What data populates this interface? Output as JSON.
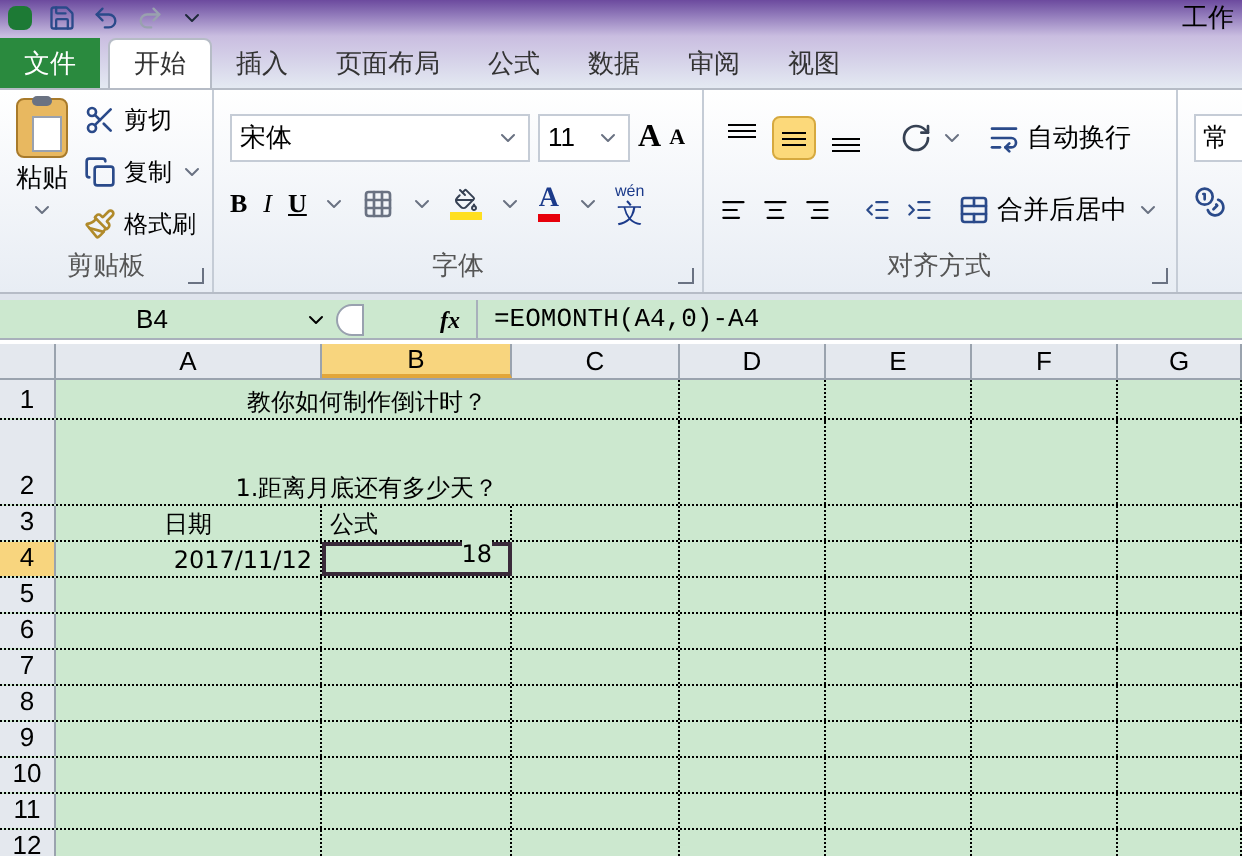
{
  "title_bar": {
    "title": "工作"
  },
  "tabs": [
    {
      "label": "文件",
      "kind": "file",
      "selected": false
    },
    {
      "label": "开始",
      "kind": "tab",
      "selected": true
    },
    {
      "label": "插入",
      "kind": "tab",
      "selected": false
    },
    {
      "label": "页面布局",
      "kind": "tab",
      "selected": false
    },
    {
      "label": "公式",
      "kind": "tab",
      "selected": false
    },
    {
      "label": "数据",
      "kind": "tab",
      "selected": false
    },
    {
      "label": "审阅",
      "kind": "tab",
      "selected": false
    },
    {
      "label": "视图",
      "kind": "tab",
      "selected": false
    }
  ],
  "clipboard": {
    "paste": "粘贴",
    "cut": "剪切",
    "copy": "复制",
    "format_painter": "格式刷",
    "label": "剪贴板"
  },
  "font": {
    "name": "宋体",
    "size": "11",
    "grow": "A",
    "shrink": "A",
    "bold": "B",
    "italic": "I",
    "underline": "U",
    "font_color": "A",
    "phonetic_top": "wén",
    "phonetic": "文",
    "label": "字体"
  },
  "alignment": {
    "vertical": [
      {
        "kind": "top",
        "selected": false
      },
      {
        "kind": "middle",
        "selected": true
      },
      {
        "kind": "bottom",
        "selected": false
      }
    ],
    "wrap": "自动换行",
    "merge": "合并后居中",
    "label": "对齐方式"
  },
  "number": {
    "format": "常"
  },
  "formula_bar": {
    "name_box": "B4",
    "fx": "fx",
    "formula": "=EOMONTH(A4,0)-A4"
  },
  "sheet": {
    "columns": [
      {
        "label": "A",
        "selected": false
      },
      {
        "label": "B",
        "selected": true
      },
      {
        "label": "C",
        "selected": false
      },
      {
        "label": "D",
        "selected": false
      },
      {
        "label": "E",
        "selected": false
      },
      {
        "label": "F",
        "selected": false
      },
      {
        "label": "G",
        "selected": false
      }
    ],
    "rows": [
      {
        "label": "1",
        "selected": false,
        "cells": [
          {
            "kind": "merged",
            "text": "教你如何制作倒计时？",
            "selected": false
          }
        ]
      },
      {
        "label": "2",
        "selected": false,
        "cells": [
          {
            "kind": "merged",
            "text": "1.距离月底还有多少天？",
            "selected": false
          }
        ]
      },
      {
        "label": "3",
        "selected": false,
        "cells": [
          {
            "kind": "centered",
            "text": "日期",
            "selected": false
          },
          {
            "kind": "text",
            "text": "公式",
            "selected": false
          }
        ]
      },
      {
        "label": "4",
        "selected": true,
        "cells": [
          {
            "kind": "number",
            "text": "2017/11/12",
            "selected": false
          },
          {
            "kind": "number",
            "text": "18",
            "selected": true
          }
        ]
      },
      {
        "label": "5",
        "selected": false,
        "cells": []
      },
      {
        "label": "6",
        "selected": false,
        "cells": []
      },
      {
        "label": "7",
        "selected": false,
        "cells": []
      },
      {
        "label": "8",
        "selected": false,
        "cells": []
      },
      {
        "label": "9",
        "selected": false,
        "cells": []
      },
      {
        "label": "10",
        "selected": false,
        "cells": []
      },
      {
        "label": "11",
        "selected": false,
        "cells": []
      },
      {
        "label": "12",
        "selected": false,
        "cells": []
      }
    ]
  }
}
